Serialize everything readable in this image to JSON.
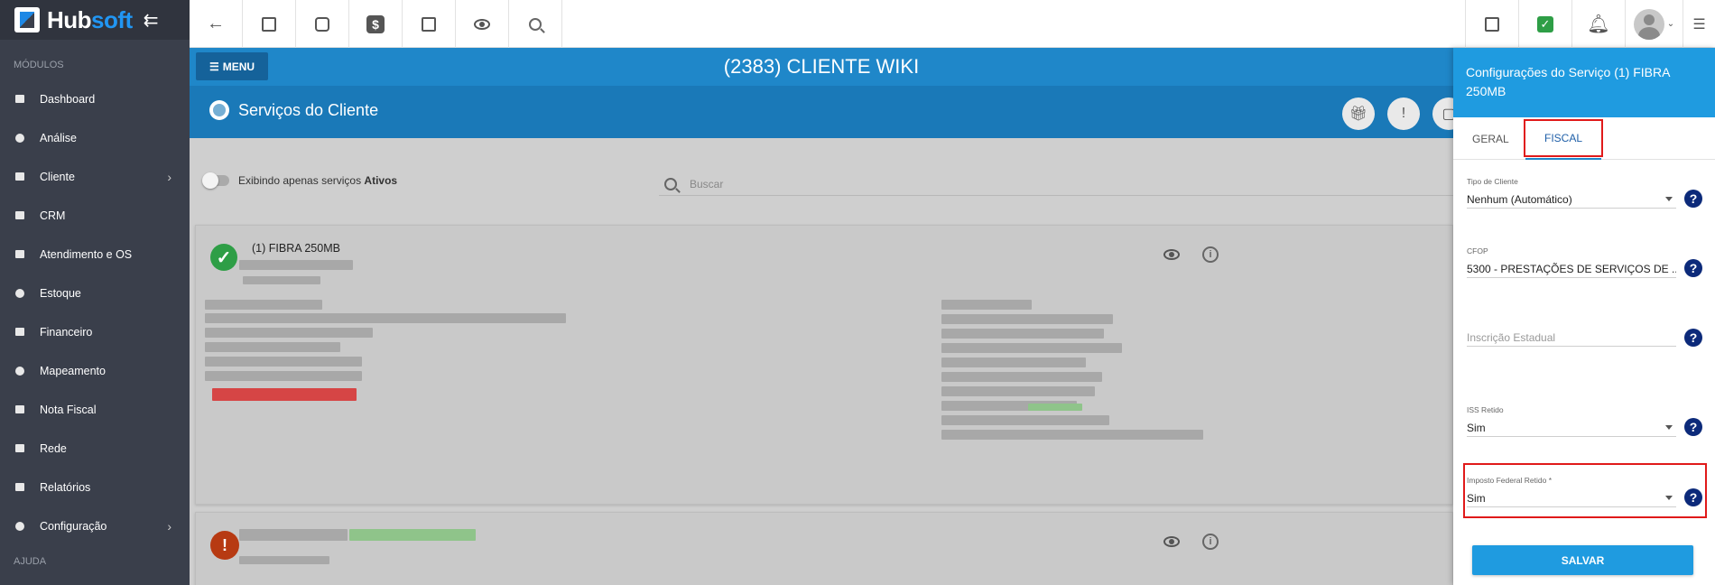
{
  "sidebar": {
    "logo_text_white": "Hub",
    "logo_text_blue": "soft",
    "section_modules": "MÓDULOS",
    "section_help": "AJUDA",
    "items": [
      {
        "label": "Dashboard"
      },
      {
        "label": "Análise"
      },
      {
        "label": "Cliente"
      },
      {
        "label": "CRM"
      },
      {
        "label": "Atendimento e OS"
      },
      {
        "label": "Estoque"
      },
      {
        "label": "Financeiro"
      },
      {
        "label": "Mapeamento"
      },
      {
        "label": "Nota Fiscal"
      },
      {
        "label": "Rede"
      },
      {
        "label": "Relatórios"
      },
      {
        "label": "Configuração"
      }
    ]
  },
  "header": {
    "menu_label": "MENU",
    "client_title": "(2383) CLIENTE WIKI",
    "services_title": "Serviços do Cliente"
  },
  "main": {
    "toggle_text": "Exibindo apenas serviços",
    "toggle_text_bold": "Ativos",
    "search_placeholder": "Buscar",
    "cards": [
      {
        "title": "(1) FIBRA 250MB",
        "status": "active"
      },
      {
        "title": "",
        "status": "warning"
      }
    ]
  },
  "panel": {
    "title": "Configurações do Serviço (1) FIBRA 250MB",
    "tabs": [
      {
        "label": "GERAL"
      },
      {
        "label": "FISCAL"
      }
    ],
    "fields": [
      {
        "label": "Tipo de Cliente",
        "value": "Nenhum (Automático)"
      },
      {
        "label": "CFOP",
        "value": "5300 - PRESTAÇÕES DE SERVIÇOS DE ..."
      },
      {
        "label": "",
        "value": "Inscrição Estadual"
      },
      {
        "label": "ISS Retido",
        "value": "Sim"
      },
      {
        "label": "Imposto Federal Retido *",
        "value": "Sim"
      }
    ],
    "save_label": "SALVAR"
  },
  "colors": {
    "sidebar_bg": "#3a3f4b",
    "header_blue": "#1a79b8",
    "panel_blue": "#1f9be0",
    "highlight_red": "#e01a1a",
    "help_navy": "#0c2a7a",
    "ok_green": "#2e9e46",
    "warn_red": "#b73a12"
  }
}
